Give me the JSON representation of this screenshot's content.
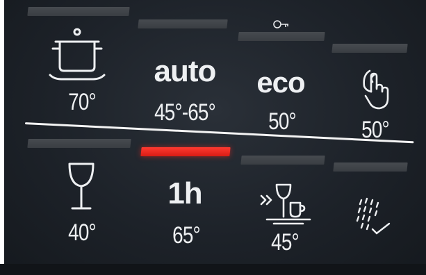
{
  "panel": {
    "top_row": [
      {
        "id": "pot",
        "icon": "cooking-pot-icon",
        "temp": "70°"
      },
      {
        "id": "auto",
        "name": "auto",
        "temp": "45°-65°"
      },
      {
        "id": "eco",
        "name": "eco",
        "temp": "50°",
        "extra_icon": "key-icon"
      },
      {
        "id": "silence",
        "icon": "silence-hand-icon",
        "temp": "50°"
      }
    ],
    "bottom_row": [
      {
        "id": "glass",
        "icon": "wine-glass-icon",
        "temp": "40°"
      },
      {
        "id": "quick",
        "name": "1h",
        "temp": "65°",
        "active": true
      },
      {
        "id": "machine-care",
        "icon": "glass-cup-icon",
        "temp": "45°"
      },
      {
        "id": "prerinse",
        "icon": "shower-rinse-icon"
      }
    ]
  },
  "colors": {
    "background": "#1d2229",
    "inactive_indicator": "#474b50",
    "active_indicator": "#ff3a30",
    "text": "#eef0f2"
  }
}
